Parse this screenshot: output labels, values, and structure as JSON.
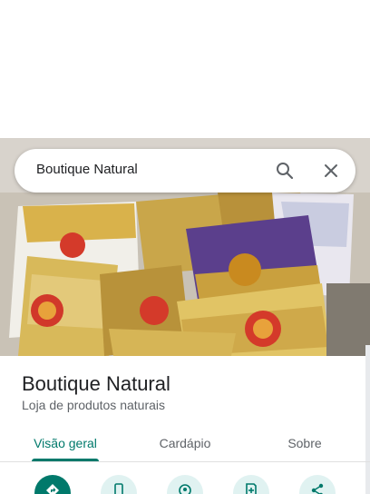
{
  "search": {
    "query": "Boutique Natural",
    "search_icon": "search-icon",
    "close_icon": "close-icon"
  },
  "place": {
    "name": "Boutique Natural",
    "category": "Loja de produtos naturais",
    "photo_description_icon": "storefront-photo"
  },
  "tabs": [
    {
      "label": "Visão geral",
      "active": true
    },
    {
      "label": "Cardápio",
      "active": false
    },
    {
      "label": "Sobre",
      "active": false
    }
  ],
  "actions": [
    {
      "icon": "directions-icon",
      "primary": true
    },
    {
      "icon": "phone-icon",
      "primary": false
    },
    {
      "icon": "nearby-icon",
      "primary": false
    },
    {
      "icon": "save-icon",
      "primary": false
    },
    {
      "icon": "share-icon",
      "primary": false
    }
  ],
  "colors": {
    "accent": "#00796b",
    "action_bg": "#e0f2f1",
    "text_primary": "#202124",
    "text_secondary": "#5f6368"
  }
}
